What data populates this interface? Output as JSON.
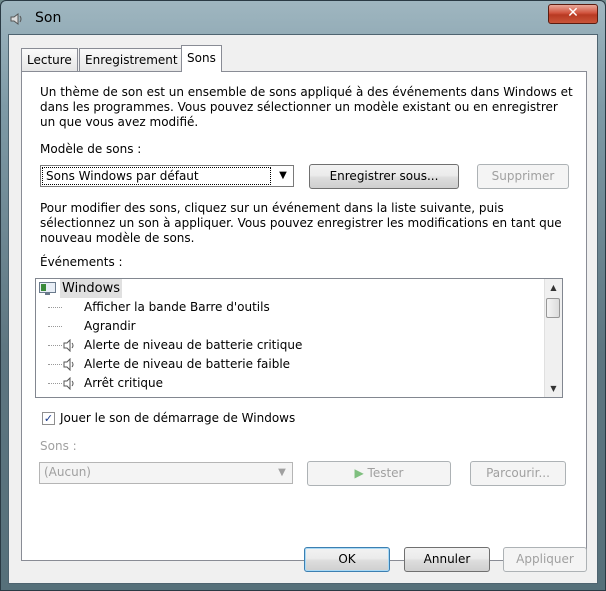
{
  "window": {
    "title": "Son",
    "close_glyph": "✕"
  },
  "tabs": [
    {
      "label": "Lecture"
    },
    {
      "label": "Enregistrement"
    },
    {
      "label": "Sons"
    }
  ],
  "intro_text": "Un thème de son est un ensemble de sons appliqué à des événements dans Windows et dans les programmes. Vous pouvez sélectionner un modèle existant ou en enregistrer un que vous avez modifié.",
  "scheme": {
    "label": "Modèle de sons :",
    "selected": "Sons Windows par défaut",
    "save_as_label": "Enregistrer sous...",
    "delete_label": "Supprimer"
  },
  "instructions_text": "Pour modifier des sons, cliquez sur un événement dans la liste suivante, puis sélectionnez un son à appliquer. Vous pouvez enregistrer les modifications en tant que nouveau modèle de sons.",
  "events": {
    "label": "Événements :",
    "root": "Windows",
    "items": [
      {
        "label": "Afficher la bande Barre d'outils",
        "has_sound": false
      },
      {
        "label": "Agrandir",
        "has_sound": false
      },
      {
        "label": "Alerte de niveau de batterie critique",
        "has_sound": true
      },
      {
        "label": "Alerte de niveau de batterie faible",
        "has_sound": true
      },
      {
        "label": "Arrêt critique",
        "has_sound": true
      }
    ]
  },
  "startup_sound": {
    "label": "Jouer le son de démarrage de Windows",
    "checked": true
  },
  "sounds": {
    "label": "Sons :",
    "selected": "(Aucun)",
    "test_label": "Tester",
    "browse_label": "Parcourir..."
  },
  "footer": {
    "ok_label": "OK",
    "cancel_label": "Annuler",
    "apply_label": "Appliquer"
  },
  "icons": {
    "title": "speaker-icon",
    "root": "windows-monitor-icon",
    "event_sound": "speaker-icon",
    "test": "play-icon",
    "check": "checkmark-icon"
  }
}
